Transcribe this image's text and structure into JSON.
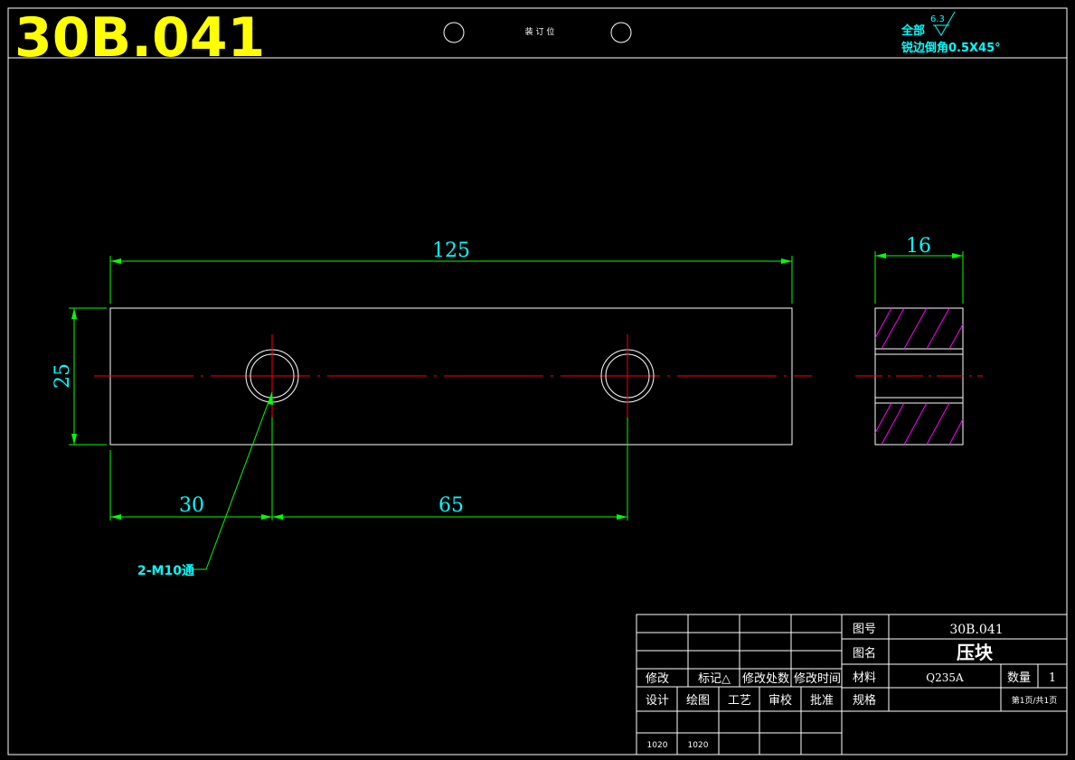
{
  "header": {
    "drawing_code": "30B.041",
    "binding_label": "装 订 位",
    "surface_note": "全部",
    "roughness_value": "6.3",
    "chamfer_note": "锐边倒角0.5X45°"
  },
  "dimensions": {
    "overall_length": "125",
    "height": "25",
    "thickness": "16",
    "hole_offset": "30",
    "hole_spacing": "65",
    "hole_callout": "2-M10通"
  },
  "title_block": {
    "revision_headers": [
      "修改",
      "标记△",
      "修改处数",
      "修改时间"
    ],
    "approval_headers": [
      "设计",
      "绘图",
      "工艺",
      "审校",
      "批准"
    ],
    "signatures": [
      "1020",
      "1020"
    ],
    "label_drawing_no": "图号",
    "drawing_no": "30B.041",
    "label_name": "图名",
    "part_name": "压块",
    "label_material": "材料",
    "material": "Q235A",
    "label_quantity": "数量",
    "quantity": "1",
    "label_spec": "规格",
    "sheet": "第1页/共1页"
  },
  "colors": {
    "outline": "#ffffff",
    "dimension": "#00ff00",
    "dimension_text": "#00ffff",
    "centerline": "#ff0000",
    "hatch": "#ff00ff",
    "code": "#ffff00"
  }
}
